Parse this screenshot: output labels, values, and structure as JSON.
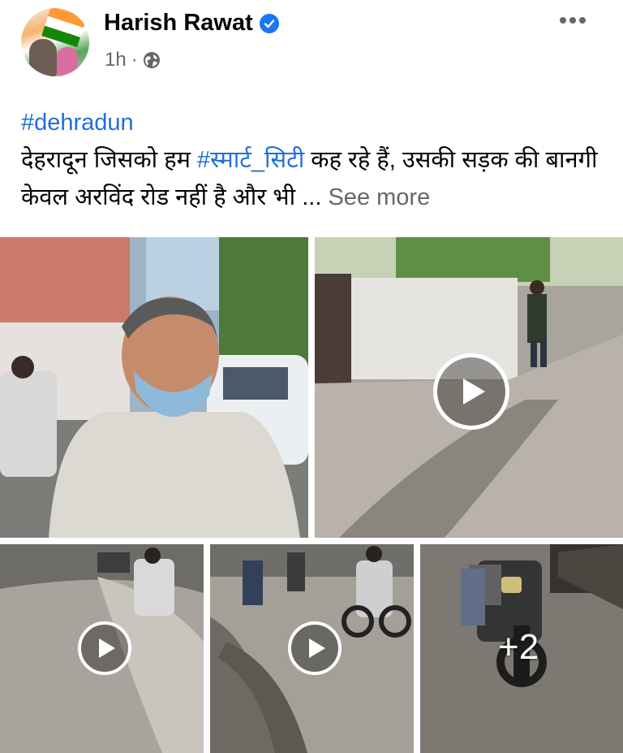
{
  "post": {
    "author": "Harish Rawat",
    "time": "1h",
    "separator": "·",
    "hashtag": "#dehradun",
    "text_part1": "देहरादून जिसको हम ",
    "text_hashtag": "#स्मार्ट_सिटी",
    "text_part2": " कह रहे हैं, उसकी सड़क की बानगी केवल अरविंद रोड नहीं है और भी ... ",
    "see_more": "See more"
  },
  "media": {
    "extra_count": "+2"
  },
  "icons": {
    "verified": "verified-badge-icon",
    "audience": "globe-icon",
    "options": "more-options-icon",
    "play": "play-icon"
  },
  "colors": {
    "link_blue": "#216fdb",
    "verified_blue": "#1877f2",
    "meta_gray": "#65676b"
  }
}
